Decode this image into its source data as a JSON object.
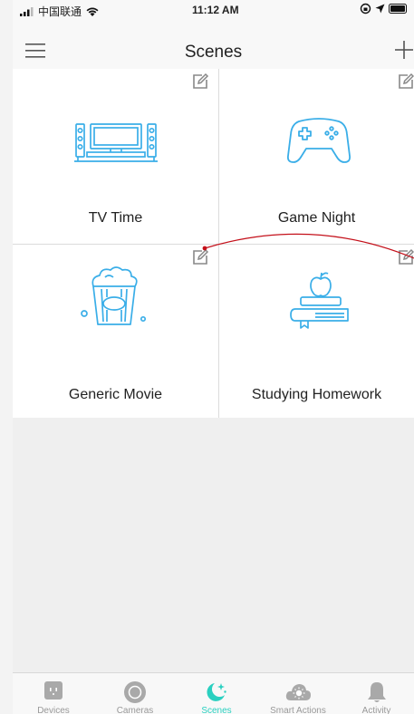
{
  "status_bar": {
    "carrier": "中国联通",
    "time": "11:12 AM"
  },
  "header": {
    "title": "Scenes"
  },
  "scenes": [
    {
      "label": "TV Time",
      "icon": "tv-icon"
    },
    {
      "label": "Game Night",
      "icon": "gamepad-icon"
    },
    {
      "label": "Generic Movie",
      "icon": "popcorn-icon"
    },
    {
      "label": "Studying Homework",
      "icon": "books-apple-icon"
    }
  ],
  "tabs": [
    {
      "label": "Devices",
      "icon": "plug-icon",
      "active": false
    },
    {
      "label": "Cameras",
      "icon": "camera-icon",
      "active": false
    },
    {
      "label": "Scenes",
      "icon": "moon-stars-icon",
      "active": true
    },
    {
      "label": "Smart Actions",
      "icon": "cloud-sun-icon",
      "active": false
    },
    {
      "label": "Activity",
      "icon": "bell-icon",
      "active": false
    }
  ],
  "colors": {
    "accent": "#2ad0c0",
    "icon_blue": "#3aaee8",
    "annotation_red": "#c4101a"
  }
}
